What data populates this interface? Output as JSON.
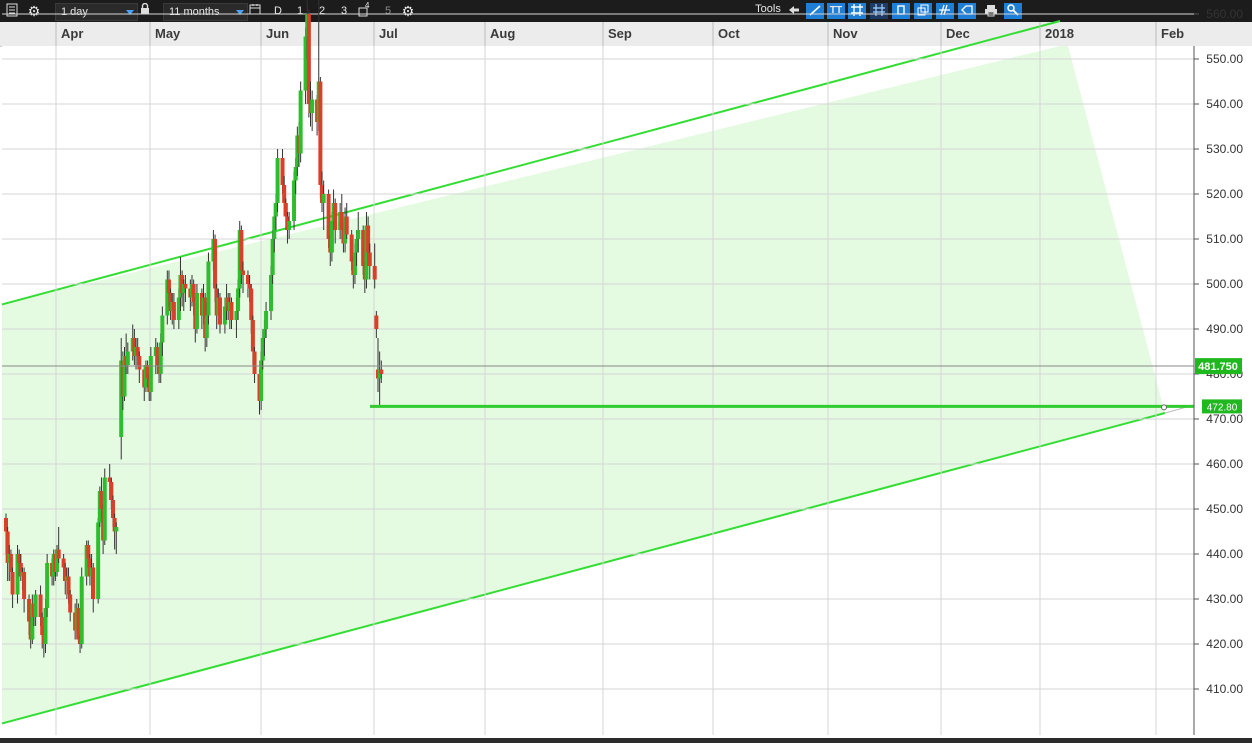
{
  "toolbar": {
    "interval": "1 day",
    "range": "11 months",
    "period_buttons": [
      "D",
      "1",
      "2",
      "3"
    ],
    "period_superscript": "4",
    "period_disabled": "5",
    "tools_label": "Tools",
    "text_tool": "TT"
  },
  "chart_data": {
    "type": "candlestick",
    "month_labels": [
      "Apr",
      "May",
      "Jun",
      "Jul",
      "Aug",
      "Sep",
      "Oct",
      "Nov",
      "Dec",
      "2018",
      "Feb"
    ],
    "y_ticks": [
      "410.00",
      "420.00",
      "430.00",
      "440.00",
      "450.00",
      "460.00",
      "470.00",
      "480.00",
      "490.00",
      "500.00",
      "510.00",
      "520.00",
      "530.00",
      "540.00",
      "550.00",
      "560.00"
    ],
    "ylim": [
      402,
      566
    ],
    "last_price": "481.750",
    "support_level": "472.80",
    "up_color": "#2dbd2d",
    "down_color": "#d8402a",
    "channel_color": "#33dd33",
    "channel_fill": "#e4fbe1",
    "start_date": "2017-03-27",
    "candles": [
      [
        448,
        449,
        440,
        445
      ],
      [
        445,
        446,
        434,
        438
      ],
      [
        438,
        442,
        434,
        440
      ],
      [
        440,
        441,
        434,
        436
      ],
      [
        436,
        437,
        428,
        431
      ],
      [
        431,
        442,
        429,
        440
      ],
      [
        440,
        441,
        435,
        438
      ],
      [
        438,
        440,
        434,
        435
      ],
      [
        435,
        437,
        432,
        436
      ],
      [
        436,
        437,
        427,
        430
      ],
      [
        430,
        431,
        422,
        425
      ],
      [
        425,
        426,
        419,
        421
      ],
      [
        421,
        431,
        420,
        429
      ],
      [
        429,
        431,
        424,
        426
      ],
      [
        426,
        432,
        424,
        431
      ],
      [
        431,
        433,
        424,
        426
      ],
      [
        426,
        427,
        419,
        422
      ],
      [
        422,
        424,
        417,
        420
      ],
      [
        420,
        430,
        418,
        428
      ],
      [
        428,
        440,
        426,
        438
      ],
      [
        438,
        439,
        433,
        435
      ],
      [
        435,
        441,
        433,
        440
      ],
      [
        440,
        441,
        434,
        436
      ],
      [
        436,
        442,
        435,
        441
      ],
      [
        441,
        446,
        438,
        439
      ],
      [
        439,
        440,
        434,
        437
      ],
      [
        437,
        438,
        431,
        434
      ],
      [
        434,
        437,
        430,
        435
      ],
      [
        435,
        437,
        429,
        431
      ],
      [
        431,
        432,
        425,
        427
      ],
      [
        427,
        429,
        421,
        423
      ],
      [
        423,
        430,
        421,
        428
      ],
      [
        428,
        429,
        420,
        421
      ],
      [
        421,
        422,
        418,
        420
      ],
      [
        420,
        437,
        419,
        435
      ],
      [
        435,
        443,
        433,
        442
      ],
      [
        442,
        443,
        437,
        439
      ],
      [
        439,
        440,
        433,
        435
      ],
      [
        435,
        440,
        430,
        437
      ],
      [
        437,
        438,
        427,
        430
      ],
      [
        430,
        448,
        429,
        447
      ],
      [
        447,
        455,
        446,
        454
      ],
      [
        454,
        457,
        448,
        450
      ],
      [
        450,
        451,
        440,
        443
      ],
      [
        443,
        459,
        442,
        457
      ],
      [
        457,
        460,
        452,
        456
      ],
      [
        456,
        457,
        450,
        452
      ],
      [
        452,
        453,
        446,
        448
      ],
      [
        448,
        449,
        441,
        445
      ],
      [
        445,
        447,
        440,
        446
      ],
      [
        466,
        488,
        461,
        483
      ],
      [
        483,
        485,
        472,
        475
      ],
      [
        475,
        486,
        474,
        484
      ],
      [
        484,
        489,
        480,
        482
      ],
      [
        482,
        487,
        480,
        485
      ],
      [
        485,
        491,
        483,
        488
      ],
      [
        488,
        490,
        482,
        484
      ],
      [
        484,
        488,
        481,
        486
      ],
      [
        486,
        488,
        482,
        484
      ],
      [
        484,
        485,
        478,
        481
      ],
      [
        481,
        482,
        474,
        477
      ],
      [
        477,
        483,
        476,
        482
      ],
      [
        482,
        483,
        477,
        479
      ],
      [
        479,
        480,
        474,
        476
      ],
      [
        476,
        486,
        474,
        484
      ],
      [
        484,
        488,
        480,
        486
      ],
      [
        486,
        487,
        480,
        482
      ],
      [
        482,
        484,
        478,
        480
      ],
      [
        480,
        489,
        478,
        487
      ],
      [
        487,
        495,
        484,
        493
      ],
      [
        493,
        503,
        491,
        501
      ],
      [
        501,
        503,
        495,
        498
      ],
      [
        498,
        499,
        492,
        494
      ],
      [
        494,
        498,
        491,
        496
      ],
      [
        496,
        498,
        490,
        492
      ],
      [
        492,
        499,
        490,
        497
      ],
      [
        497,
        506,
        494,
        502
      ],
      [
        502,
        503,
        495,
        498
      ],
      [
        498,
        501,
        494,
        500
      ],
      [
        500,
        502,
        496,
        499
      ],
      [
        499,
        501,
        494,
        497
      ],
      [
        497,
        502,
        495,
        500
      ],
      [
        500,
        501,
        493,
        496
      ],
      [
        496,
        497,
        487,
        490
      ],
      [
        490,
        500,
        489,
        498
      ],
      [
        498,
        499,
        490,
        493
      ],
      [
        493,
        500,
        491,
        497
      ],
      [
        497,
        498,
        485,
        488
      ],
      [
        488,
        496,
        486,
        493
      ],
      [
        493,
        507,
        491,
        505
      ],
      [
        505,
        512,
        503,
        510
      ],
      [
        510,
        511,
        496,
        499
      ],
      [
        499,
        500,
        490,
        493
      ],
      [
        493,
        499,
        491,
        497
      ],
      [
        497,
        498,
        489,
        491
      ],
      [
        491,
        497,
        489,
        495
      ],
      [
        495,
        500,
        492,
        497
      ],
      [
        497,
        498,
        492,
        494
      ],
      [
        494,
        498,
        490,
        496
      ],
      [
        496,
        497,
        490,
        492
      ],
      [
        492,
        497,
        488,
        494
      ],
      [
        494,
        501,
        492,
        499
      ],
      [
        499,
        514,
        497,
        512
      ],
      [
        512,
        513,
        500,
        503
      ],
      [
        503,
        505,
        498,
        502
      ],
      [
        502,
        503,
        497,
        500
      ],
      [
        500,
        502,
        496,
        499
      ],
      [
        499,
        500,
        489,
        492
      ],
      [
        492,
        493,
        482,
        485
      ],
      [
        485,
        486,
        478,
        480
      ],
      [
        480,
        481,
        471,
        474
      ],
      [
        474,
        485,
        472,
        483
      ],
      [
        483,
        490,
        481,
        488
      ],
      [
        488,
        492,
        484,
        490
      ],
      [
        490,
        496,
        488,
        494
      ],
      [
        494,
        504,
        492,
        502
      ],
      [
        502,
        512,
        500,
        510
      ],
      [
        510,
        518,
        507,
        515
      ],
      [
        515,
        520,
        512,
        518
      ],
      [
        518,
        530,
        516,
        528
      ],
      [
        528,
        530,
        520,
        522
      ],
      [
        522,
        524,
        515,
        518
      ],
      [
        518,
        519,
        512,
        515
      ],
      [
        515,
        516,
        509,
        512
      ],
      [
        512,
        516,
        510,
        514
      ],
      [
        514,
        525,
        512,
        523
      ],
      [
        523,
        528,
        520,
        526
      ],
      [
        526,
        535,
        524,
        533
      ],
      [
        533,
        536,
        526,
        529
      ],
      [
        529,
        545,
        527,
        543
      ],
      [
        543,
        557,
        540,
        555
      ],
      [
        555,
        563,
        550,
        560
      ],
      [
        560,
        561,
        537,
        540
      ],
      [
        540,
        545,
        535,
        538
      ],
      [
        538,
        543,
        534,
        541
      ],
      [
        541,
        542,
        533,
        536
      ],
      [
        536,
        564,
        534,
        545
      ],
      [
        545,
        546,
        519,
        522
      ],
      [
        522,
        525,
        516,
        518
      ],
      [
        518,
        523,
        512,
        520
      ],
      [
        520,
        521,
        508,
        510
      ],
      [
        510,
        511,
        504,
        507
      ],
      [
        507,
        516,
        505,
        514
      ],
      [
        514,
        521,
        512,
        518
      ],
      [
        518,
        519,
        509,
        512
      ],
      [
        512,
        518,
        510,
        516
      ],
      [
        516,
        520,
        510,
        512
      ],
      [
        512,
        514,
        507,
        509
      ],
      [
        509,
        517,
        507,
        515
      ],
      [
        515,
        518,
        510,
        511
      ],
      [
        511,
        512,
        503,
        505
      ],
      [
        505,
        506,
        499,
        502
      ],
      [
        502,
        509,
        500,
        507
      ],
      [
        507,
        512,
        504,
        510
      ],
      [
        510,
        516,
        507,
        512
      ],
      [
        512,
        513,
        502,
        504
      ],
      [
        504,
        505,
        498,
        501
      ],
      [
        501,
        516,
        499,
        513
      ],
      [
        513,
        515,
        504,
        507
      ],
      [
        507,
        509,
        501,
        504
      ],
      [
        504,
        509,
        499,
        501
      ],
      [
        493,
        494,
        488,
        490
      ],
      [
        481,
        488,
        476,
        479
      ],
      [
        479,
        485,
        473,
        481
      ],
      [
        481,
        483,
        478,
        480
      ]
    ]
  }
}
